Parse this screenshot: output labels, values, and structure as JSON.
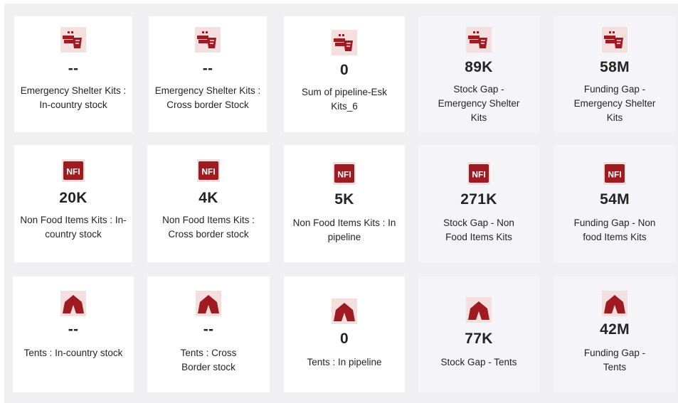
{
  "colors": {
    "icon_red": "#9e1b22",
    "icon_bg": "#f4dede",
    "card_bg": "#ffffff",
    "gap_card_bg": "#f4f4f9",
    "board_bg": "#f0eff2"
  },
  "rows": [
    {
      "icon": "emergency-shelter-kit-icon",
      "cards": [
        {
          "value": "--",
          "label": "Emergency Shelter Kits : In-country stock"
        },
        {
          "value": "--",
          "label": "Emergency Shelter Kits : Cross border Stock"
        },
        {
          "value": "0",
          "label": "Sum of pipeline-Esk Kits_6"
        },
        {
          "value": "89K",
          "label": "Stock Gap - Emergency Shelter Kits"
        },
        {
          "value": "58M",
          "label": "Funding Gap - Emergency Shelter Kits"
        }
      ]
    },
    {
      "icon": "nfi-icon",
      "icon_text": "NFI",
      "cards": [
        {
          "value": "20K",
          "label": "Non Food Items Kits : In-country stock"
        },
        {
          "value": "4K",
          "label": "Non Food Items Kits : Cross border stock"
        },
        {
          "value": "5K",
          "label": "Non Food Items Kits : In pipeline"
        },
        {
          "value": "271K",
          "label": "Stock Gap - Non Food Items Kits"
        },
        {
          "value": "54M",
          "label": "Funding Gap - Non food Items Kits"
        }
      ]
    },
    {
      "icon": "tent-icon",
      "cards": [
        {
          "value": "--",
          "label": "Tents : In-country stock"
        },
        {
          "value": "--",
          "label": "Tents : Cross Border stock"
        },
        {
          "value": "0",
          "label": "Tents : In pipeline"
        },
        {
          "value": "77K",
          "label": "Stock Gap - Tents"
        },
        {
          "value": "42M",
          "label": "Funding Gap - Tents"
        }
      ]
    }
  ]
}
